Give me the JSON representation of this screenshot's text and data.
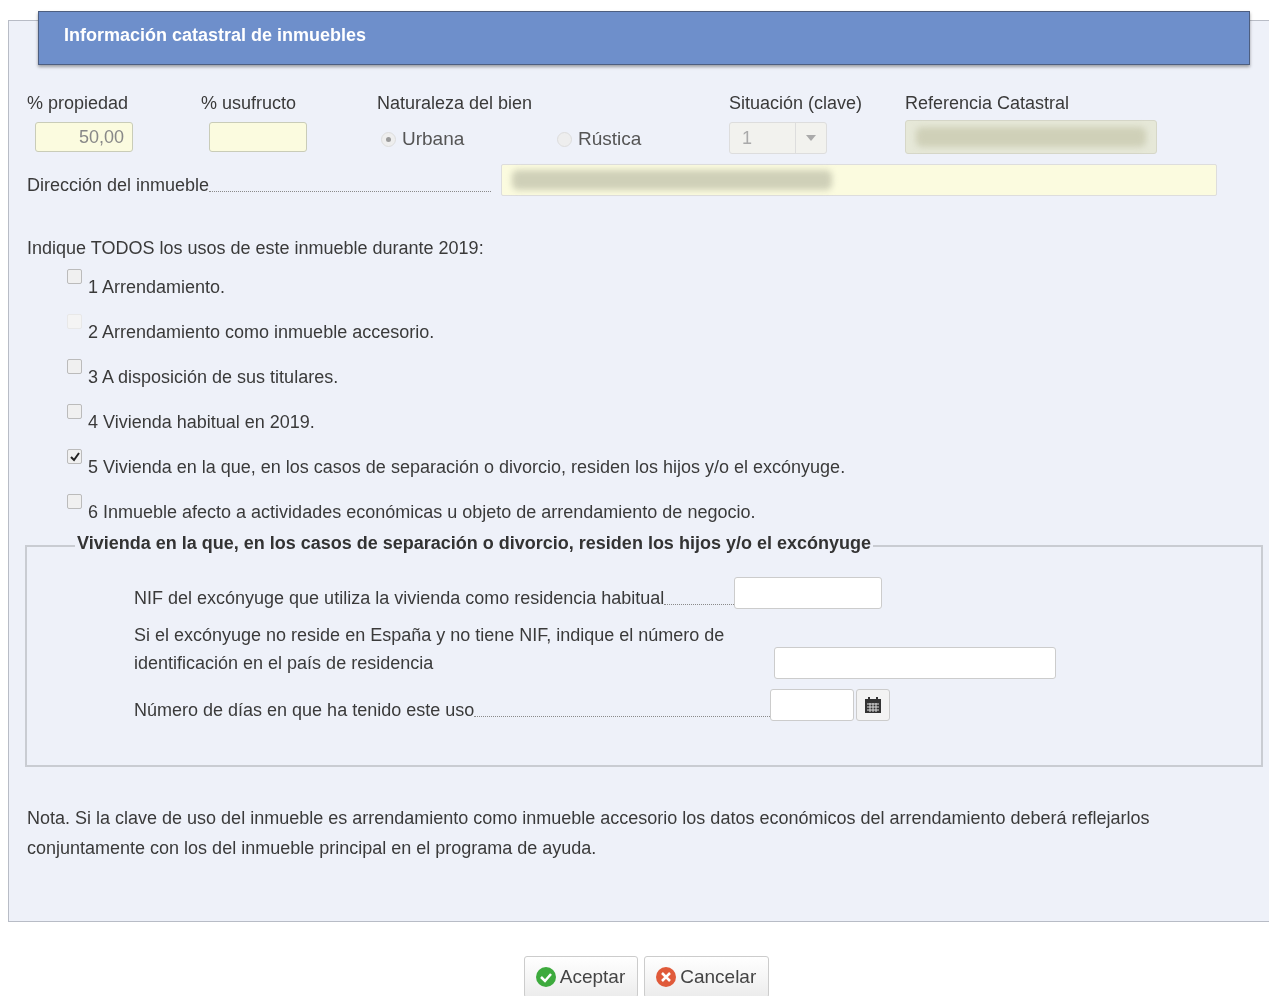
{
  "header": {
    "title": "Información catastral de inmuebles"
  },
  "fields": {
    "propiedad": {
      "label": "% propiedad",
      "value": "50,00"
    },
    "usufructo": {
      "label": "% usufructo"
    },
    "naturaleza": {
      "label": "Naturaleza del bien",
      "options": [
        {
          "label": "Urbana",
          "selected": true,
          "disabled": true
        },
        {
          "label": "Rústica",
          "selected": false,
          "disabled": true
        }
      ]
    },
    "situacion": {
      "label": "Situación (clave)",
      "value": "1",
      "disabled": true
    },
    "referencia": {
      "label": "Referencia Catastral",
      "redacted": true
    },
    "direccion": {
      "label": "Dirección del inmueble",
      "redacted": true
    }
  },
  "usos": {
    "prompt": "Indique TODOS los usos de este inmueble durante 2019:",
    "items": [
      {
        "label": "1 Arrendamiento.",
        "checked": false,
        "disabled": false
      },
      {
        "label": "2 Arrendamiento como inmueble accesorio.",
        "checked": false,
        "disabled": true
      },
      {
        "label": "3 A disposición de sus titulares.",
        "checked": false,
        "disabled": false
      },
      {
        "label": "4 Vivienda habitual en 2019.",
        "checked": false,
        "disabled": false
      },
      {
        "label": "5 Vivienda en la que, en los casos de separación o divorcio, residen los hijos y/o el excónyuge.",
        "checked": true,
        "disabled": false
      },
      {
        "label": "6 Inmueble afecto a actividades económicas u objeto de arrendamiento de negocio.",
        "checked": false,
        "disabled": false
      }
    ]
  },
  "fieldset": {
    "legend": "Vivienda en la que, en los casos de separación o divorcio, residen los hijos y/o el excónyuge",
    "rows": [
      {
        "label": "NIF del excónyuge que utiliza la vivienda como residencia habitual",
        "kind": "short"
      },
      {
        "label": "Si el excónyuge no reside en España y no tiene NIF, indique el número de identificación en el país de residencia",
        "kind": "long"
      },
      {
        "label": "Número de días en que ha tenido este uso",
        "kind": "date"
      }
    ]
  },
  "note": "Nota. Si la clave de uso del inmueble es arrendamiento como inmueble accesorio los datos económicos del arrendamiento deberá reflejarlos conjuntamente con los del inmueble principal en el programa de ayuda.",
  "buttons": [
    {
      "label": "Aceptar",
      "kind": "ok"
    },
    {
      "label": "Cancelar",
      "kind": "cancel"
    }
  ]
}
